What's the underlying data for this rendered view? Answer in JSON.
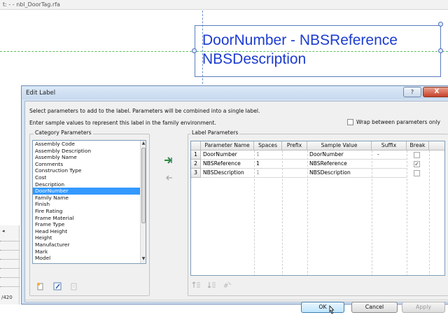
{
  "background": {
    "title": "t:  - - nbl_DoorTag.rfa",
    "label_line1": "DoorNumber - NBSReference",
    "label_line2": "NBSDescription",
    "strip_text": "/420"
  },
  "dialog": {
    "title": "Edit Label",
    "help_label": "?",
    "close_label": "X",
    "instruction1": "Select parameters to add to the label.  Parameters will be combined into a single label.",
    "instruction2": "Enter sample values to represent this label in the family environment.",
    "wrap_label": "Wrap between parameters only",
    "category_title": "Category Parameters",
    "label_title": "Label Parameters",
    "category_items": [
      "Assembly Code",
      "Assembly Description",
      "Assembly Name",
      "Comments",
      "Construction Type",
      "Cost",
      "Description",
      "DoorNumber",
      "Family Name",
      "Finish",
      "Fire Rating",
      "Frame Material",
      "Frame Type",
      "Head Height",
      "Height",
      "Manufacturer",
      "Mark",
      "Model"
    ],
    "selected_category": "DoorNumber",
    "columns": [
      "Parameter Name",
      "Spaces",
      "Prefix",
      "Sample Value",
      "Suffix",
      "Break"
    ],
    "rows": [
      {
        "num": "1",
        "name": "DoorNumber",
        "spaces": "1",
        "prefix": "",
        "sample": "DoorNumber",
        "suffix": "-",
        "break": false
      },
      {
        "num": "2",
        "name": "NBSReference",
        "spaces": "1",
        "prefix": "",
        "sample": "NBSReference",
        "suffix": "",
        "break": true
      },
      {
        "num": "3",
        "name": "NBSDescription",
        "spaces": "1",
        "prefix": "",
        "sample": "NBSDescription",
        "suffix": "",
        "break": false
      }
    ],
    "ok_label": "OK",
    "cancel_label": "Cancel",
    "apply_label": "Apply"
  },
  "colors": {
    "label_text": "#1c3cd0",
    "selection": "#3399ff",
    "reference_line": "#5bbf5b"
  }
}
